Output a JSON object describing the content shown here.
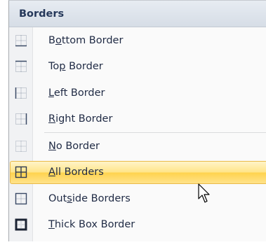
{
  "menu": {
    "header": "Borders",
    "items": [
      {
        "id": "bottom",
        "pre": "B",
        "acc": "o",
        "post": "ttom Border",
        "icon": "bottom-border-icon"
      },
      {
        "id": "top",
        "pre": "To",
        "acc": "p",
        "post": " Border",
        "icon": "top-border-icon"
      },
      {
        "id": "left",
        "pre": "",
        "acc": "L",
        "post": "eft Border",
        "icon": "left-border-icon"
      },
      {
        "id": "right",
        "pre": "",
        "acc": "R",
        "post": "ight Border",
        "icon": "right-border-icon"
      },
      {
        "id": "none",
        "pre": "",
        "acc": "N",
        "post": "o Border",
        "icon": "no-border-icon"
      },
      {
        "id": "all",
        "pre": "",
        "acc": "A",
        "post": "ll Borders",
        "icon": "all-borders-icon"
      },
      {
        "id": "outside",
        "pre": "Out",
        "acc": "s",
        "post": "ide Borders",
        "icon": "outside-borders-icon"
      },
      {
        "id": "thick",
        "pre": "",
        "acc": "T",
        "post": "hick Box Border",
        "icon": "thick-box-border-icon"
      }
    ]
  },
  "colors": {
    "highlight": "#ffe58a",
    "header_text": "#25385a",
    "item_text": "#1f2a44"
  },
  "cursor": {
    "icon": "mouse-pointer-icon"
  }
}
